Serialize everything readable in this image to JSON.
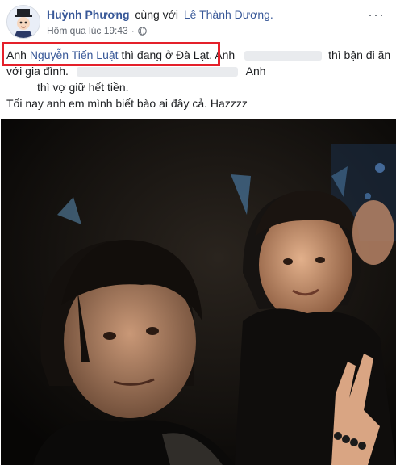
{
  "post": {
    "author_name": "Huỳnh Phương",
    "with_text": "cùng với",
    "tagged_name": "Lê Thành Dương.",
    "timestamp": "Hôm qua lúc 19:43",
    "separator": "·",
    "more_label": "···",
    "lines": {
      "l1_prefix": "Anh ",
      "l1_mention": "Nguyễn Tiến Luật",
      "l1_suffix": " thì đang ở Đà Lạt.",
      "l1_after": " Anh",
      "l1_tail": "thì bận đi ăn",
      "l2_start": "với gia đình.",
      "l2_anh": "Anh",
      "l3_text": "thì vợ giữ hết tiền.",
      "l4_text": "Tối nay anh em mình biết bào ai đây cả. Hazzzz"
    },
    "colors": {
      "link": "#385898",
      "highlight_box": "#e4202a",
      "meta": "#616770"
    },
    "icons": [
      "avatar",
      "globe-icon",
      "more-icon"
    ]
  }
}
